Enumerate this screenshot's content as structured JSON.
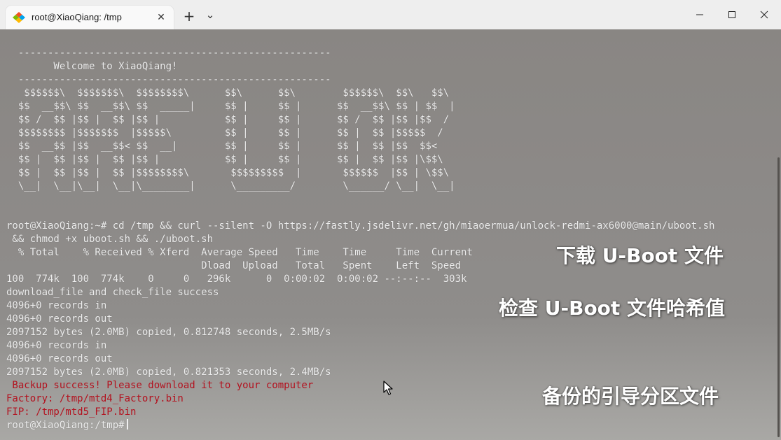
{
  "window": {
    "tab_title": "root@XiaoQiang: /tmp",
    "new_tab_symbol": "+",
    "dropdown_symbol": "⌄",
    "close_tab_symbol": "✕"
  },
  "terminal": {
    "lines": [
      {
        "text": "  -----------------------------------------------------",
        "style": "normal"
      },
      {
        "text": "        Welcome to XiaoQiang!",
        "style": "normal"
      },
      {
        "text": "  -----------------------------------------------------",
        "style": "normal"
      },
      {
        "text": "   $$$$$$\\  $$$$$$$\\  $$$$$$$$\\      $$\\      $$\\        $$$$$$\\  $$\\   $$\\",
        "style": "normal"
      },
      {
        "text": "  $$  __$$\\ $$  __$$\\ $$  _____|     $$ |     $$ |      $$  __$$\\ $$ | $$  |",
        "style": "normal"
      },
      {
        "text": "  $$ /  $$ |$$ |  $$ |$$ |           $$ |     $$ |      $$ /  $$ |$$ |$$  /",
        "style": "normal"
      },
      {
        "text": "  $$$$$$$$ |$$$$$$$  |$$$$$\\         $$ |     $$ |      $$ |  $$ |$$$$$  /",
        "style": "normal"
      },
      {
        "text": "  $$  __$$ |$$  __$$< $$  __|        $$ |     $$ |      $$ |  $$ |$$  $$<",
        "style": "normal"
      },
      {
        "text": "  $$ |  $$ |$$ |  $$ |$$ |           $$ |     $$ |      $$ |  $$ |$$ |\\$$\\",
        "style": "normal"
      },
      {
        "text": "  $$ |  $$ |$$ |  $$ |$$$$$$$$\\       $$$$$$$$$  |       $$$$$$  |$$ | \\$$\\",
        "style": "normal"
      },
      {
        "text": "  \\__|  \\__|\\__|  \\__|\\________|      \\_________/        \\______/ \\__|  \\__|",
        "style": "normal"
      },
      {
        "text": "",
        "style": "normal"
      },
      {
        "text": "",
        "style": "normal"
      },
      {
        "text": "root@XiaoQiang:~# cd /tmp && curl --silent -O https://fastly.jsdelivr.net/gh/miaoermua/unlock-redmi-ax6000@main/uboot.sh",
        "style": "normal"
      },
      {
        "text": " && chmod +x uboot.sh && ./uboot.sh",
        "style": "normal"
      },
      {
        "text": "  % Total    % Received % Xferd  Average Speed   Time    Time     Time  Current",
        "style": "normal"
      },
      {
        "text": "                                 Dload  Upload   Total   Spent    Left  Speed",
        "style": "normal"
      },
      {
        "text": "100  774k  100  774k    0     0   296k      0  0:00:02  0:00:02 --:--:--  303k",
        "style": "normal"
      },
      {
        "text": "download_file and check_file success",
        "style": "normal"
      },
      {
        "text": "4096+0 records in",
        "style": "normal"
      },
      {
        "text": "4096+0 records out",
        "style": "normal"
      },
      {
        "text": "2097152 bytes (2.0MB) copied, 0.812748 seconds, 2.5MB/s",
        "style": "normal"
      },
      {
        "text": "4096+0 records in",
        "style": "normal"
      },
      {
        "text": "4096+0 records out",
        "style": "normal"
      },
      {
        "text": "2097152 bytes (2.0MB) copied, 0.821353 seconds, 2.4MB/s",
        "style": "normal"
      },
      {
        "text": " Backup success! Please download it to your computer",
        "style": "red"
      },
      {
        "text": "Factory: /tmp/mtd4_Factory.bin",
        "style": "red"
      },
      {
        "text": "FIP: /tmp/mtd5_FIP.bin",
        "style": "red"
      }
    ],
    "prompt": "root@XiaoQiang:/tmp#"
  },
  "annotations": {
    "download": "下载 U-Boot 文件",
    "check": "检查 U-Boot 文件哈希值",
    "backup": "备份的引导分区文件"
  },
  "colors": {
    "terminal_text": "#ececec",
    "error_red": "#b3121f",
    "titlebar": "#eeeeee"
  }
}
